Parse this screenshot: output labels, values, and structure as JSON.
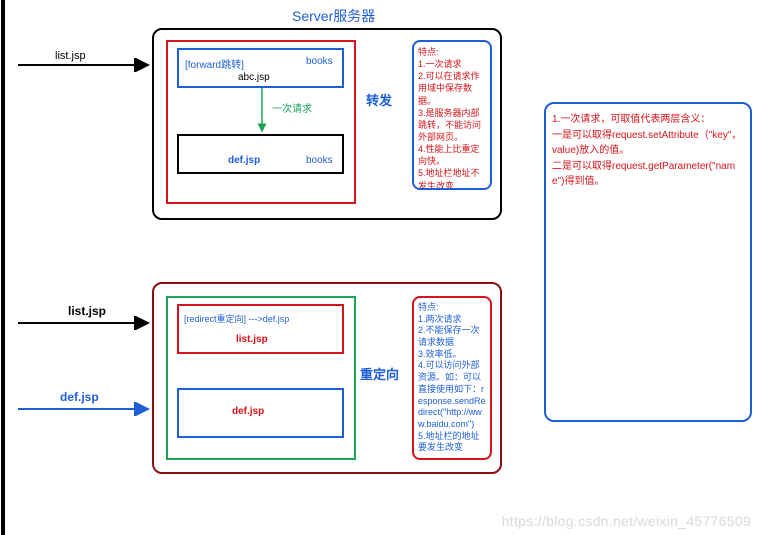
{
  "title": "Server服务器",
  "forward": {
    "incoming_label": "list.jsp",
    "inner_label_left": "[forward跳转]",
    "inner_label_right": "books",
    "abc": "abc.jsp",
    "once_request": "一次请求",
    "def": "def.jsp",
    "def_books": "books",
    "badge": "转发",
    "features_title": "特点:",
    "features": [
      "1.一次请求",
      "2.可以在请求作用域中保存数据。",
      "3.是服务器内部跳转，不能访问外部网页。",
      "4.性能上比重定向快。",
      "5.地址栏地址不发生改变"
    ]
  },
  "redirect": {
    "incoming_top": "list.jsp",
    "incoming_bottom": "def.jsp",
    "inner_label": "[redirect重定向] --->def.jsp",
    "list": "list.jsp",
    "def": "def.jsp",
    "badge": "重定向",
    "features_title": "特点:",
    "features": [
      "1.两次请求",
      "2.不能保存一次请求数据",
      "3.效率低。",
      "4.可以访问外部资源。如：可以直接使用如下：response.sendRedirect(\"http://www.baidu.com\")",
      "5.地址栏的地址要发生改变"
    ]
  },
  "note": {
    "lines": [
      "1.一次请求，可取值代表两层含义：",
      "  一是可以取得request.setAttribute（\"key\"，value)放入的值。",
      "  二是可以取得request.getParameter(\"name\")得到值。"
    ]
  },
  "watermark": "https://blog.csdn.net/weixin_45776509"
}
